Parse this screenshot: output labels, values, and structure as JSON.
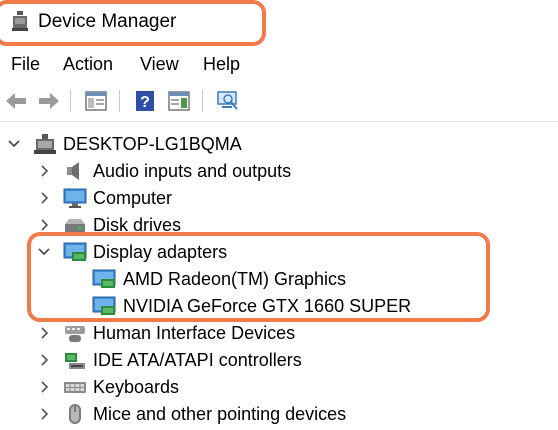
{
  "window": {
    "title": "Device Manager",
    "icon": "device-manager-icon"
  },
  "menu": [
    "File",
    "Action",
    "View",
    "Help"
  ],
  "toolbar": {
    "buttons": [
      "back-arrow-icon",
      "forward-arrow-icon",
      "show-hide-console-tree-icon",
      "help-icon",
      "action-pane-icon",
      "scan-hardware-icon"
    ]
  },
  "tree": {
    "root": "DESKTOP-LG1BQMA",
    "categories": [
      {
        "label": "Audio inputs and outputs",
        "expanded": false,
        "icon": "speaker-icon"
      },
      {
        "label": "Computer",
        "expanded": false,
        "icon": "monitor-icon"
      },
      {
        "label": "Disk drives",
        "expanded": false,
        "icon": "disk-drive-icon"
      },
      {
        "label": "Display adapters",
        "expanded": true,
        "icon": "display-adapter-icon",
        "children": [
          "AMD Radeon(TM) Graphics",
          "NVIDIA GeForce GTX 1660 SUPER"
        ]
      },
      {
        "label": "Human Interface Devices",
        "expanded": false,
        "icon": "hid-icon"
      },
      {
        "label": "IDE ATA/ATAPI controllers",
        "expanded": false,
        "icon": "ide-controller-icon"
      },
      {
        "label": "Keyboards",
        "expanded": false,
        "icon": "keyboard-icon"
      },
      {
        "label": "Mice and other pointing devices",
        "expanded": false,
        "icon": "mouse-icon"
      }
    ]
  },
  "colors": {
    "highlight": "#f07a4a",
    "adapter_green": "#2e8b3a",
    "monitor_blue": "#3a8ad6"
  }
}
